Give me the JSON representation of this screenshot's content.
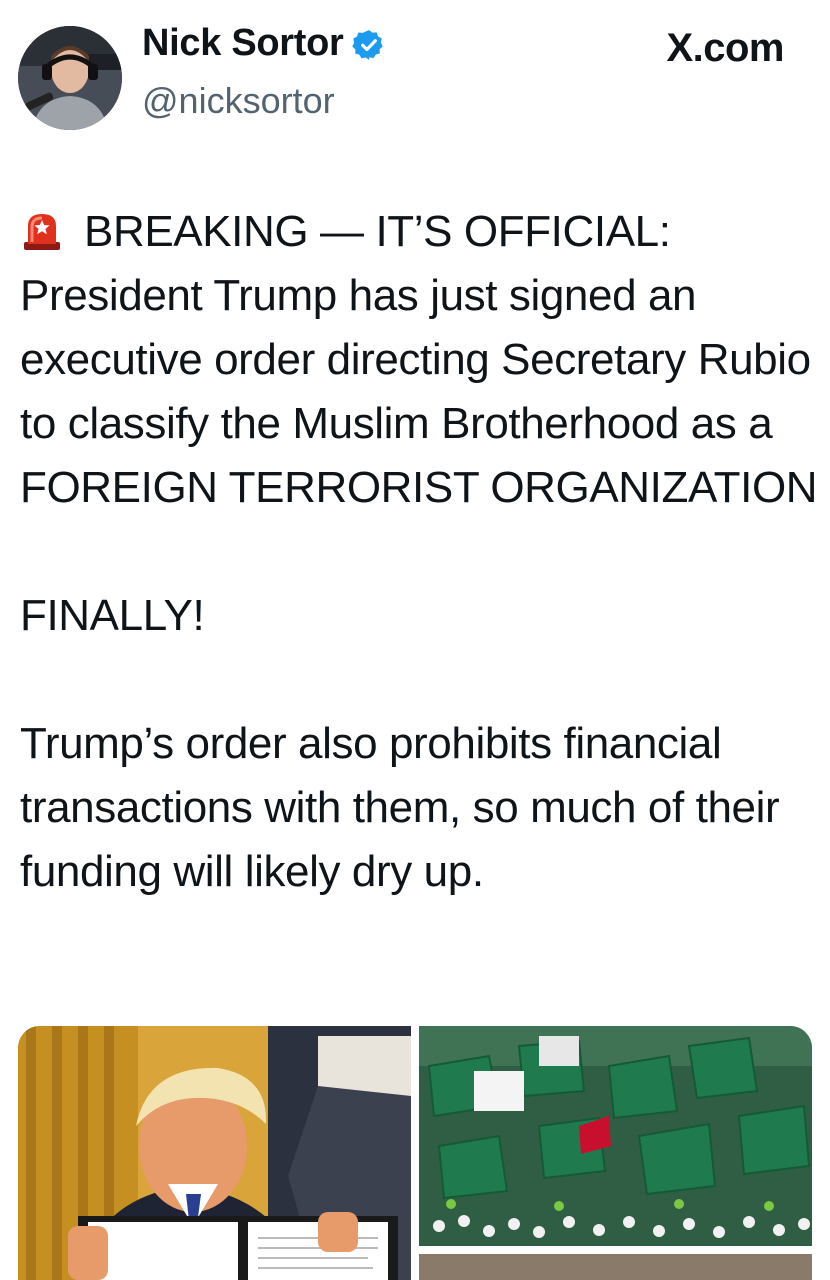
{
  "author": {
    "display_name": "Nick Sortor",
    "handle": "@nicksortor",
    "verified": true,
    "avatar_icon": "profile-photo"
  },
  "site": {
    "label": "X.com"
  },
  "tweet": {
    "emoji_icon": "police-siren-icon",
    "paragraphs": [
      "BREAKING — IT’S OFFICIAL: President Trump has just signed an executive order directing Secretary Rubio to classify the Muslim Brotherhood as a FOREIGN TERRORIST ORGANIZATION",
      "FINALLY!",
      "Trump’s order also prohibits financial transactions with them, so much of their funding will likely dry up."
    ]
  },
  "media": {
    "count": 3,
    "photos": [
      "photo-signed-order",
      "photo-crowd-green-flags",
      "photo-third"
    ]
  },
  "colors": {
    "text": "#0f1419",
    "secondary_text": "#536471",
    "verified_blue": "#1d9bf0",
    "siren_red": "#e0301e"
  }
}
